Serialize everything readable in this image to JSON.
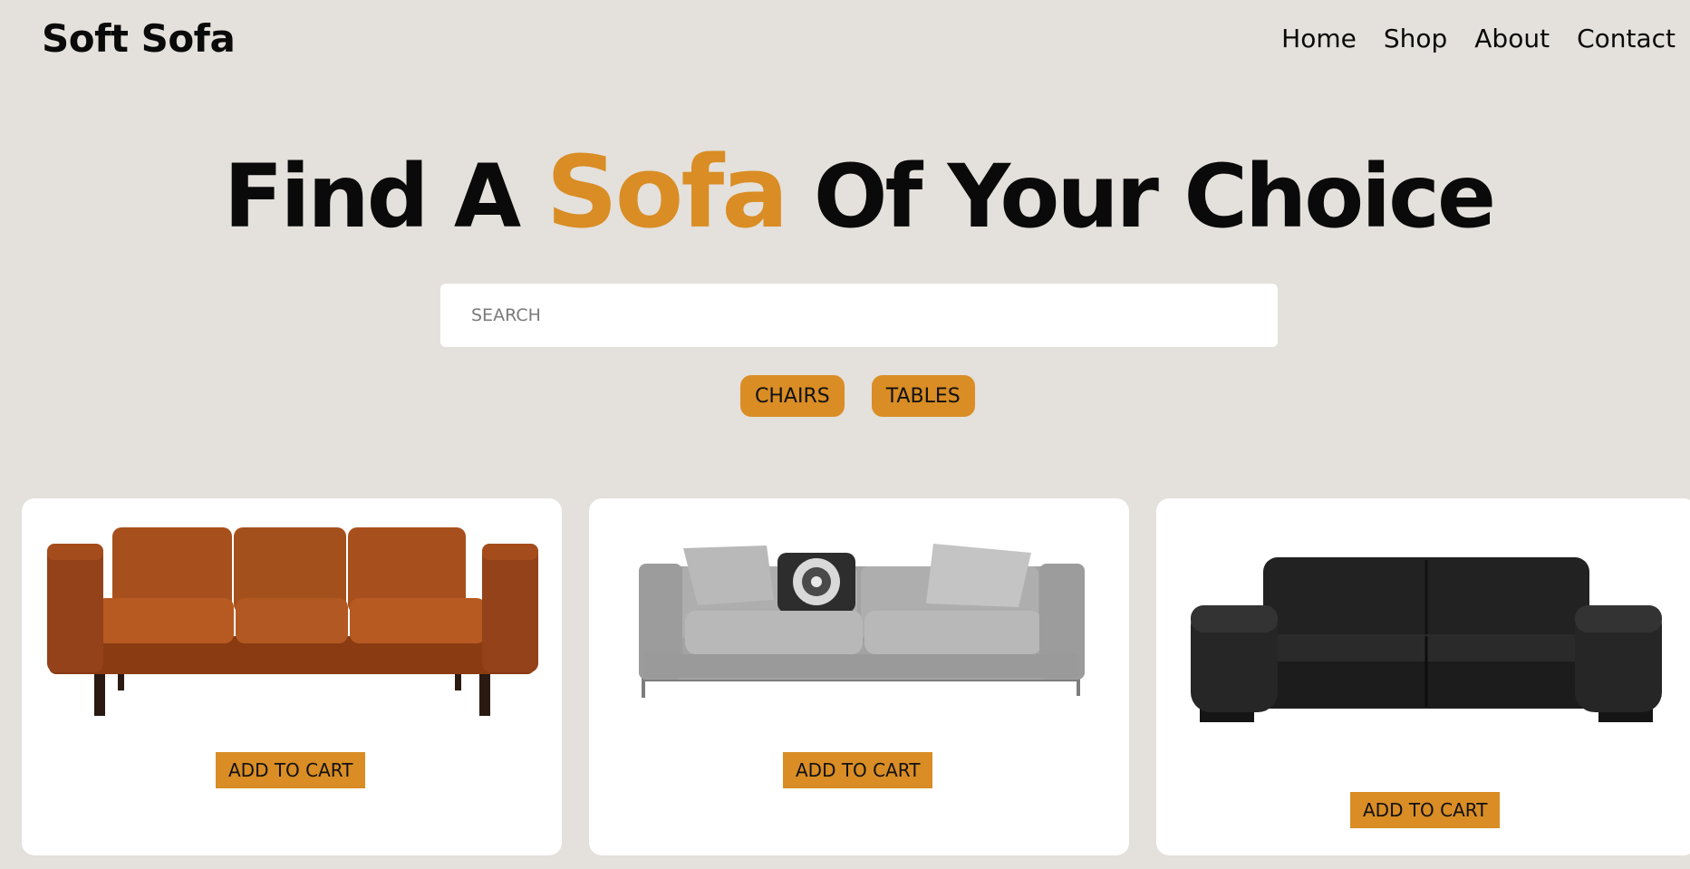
{
  "brand": {
    "name": "Soft Sofa"
  },
  "nav": {
    "items": [
      "Home",
      "Shop",
      "About",
      "Contact"
    ]
  },
  "hero": {
    "title_before": "Find A",
    "title_accent": "Sofa",
    "title_after": "Of Your Choice"
  },
  "search": {
    "placeholder": "SEARCH",
    "value": ""
  },
  "filters": [
    "CHAIRS",
    "TABLES"
  ],
  "products": [
    {
      "image": "brown-leather-sofa",
      "button_label": "ADD TO CART"
    },
    {
      "image": "grey-fabric-sofa",
      "button_label": "ADD TO CART"
    },
    {
      "image": "black-leather-sofa",
      "button_label": "ADD TO CART"
    }
  ],
  "colors": {
    "background": "#e4e0db",
    "accent": "#d98d24",
    "card": "#ffffff",
    "text": "#0a0a0a"
  }
}
